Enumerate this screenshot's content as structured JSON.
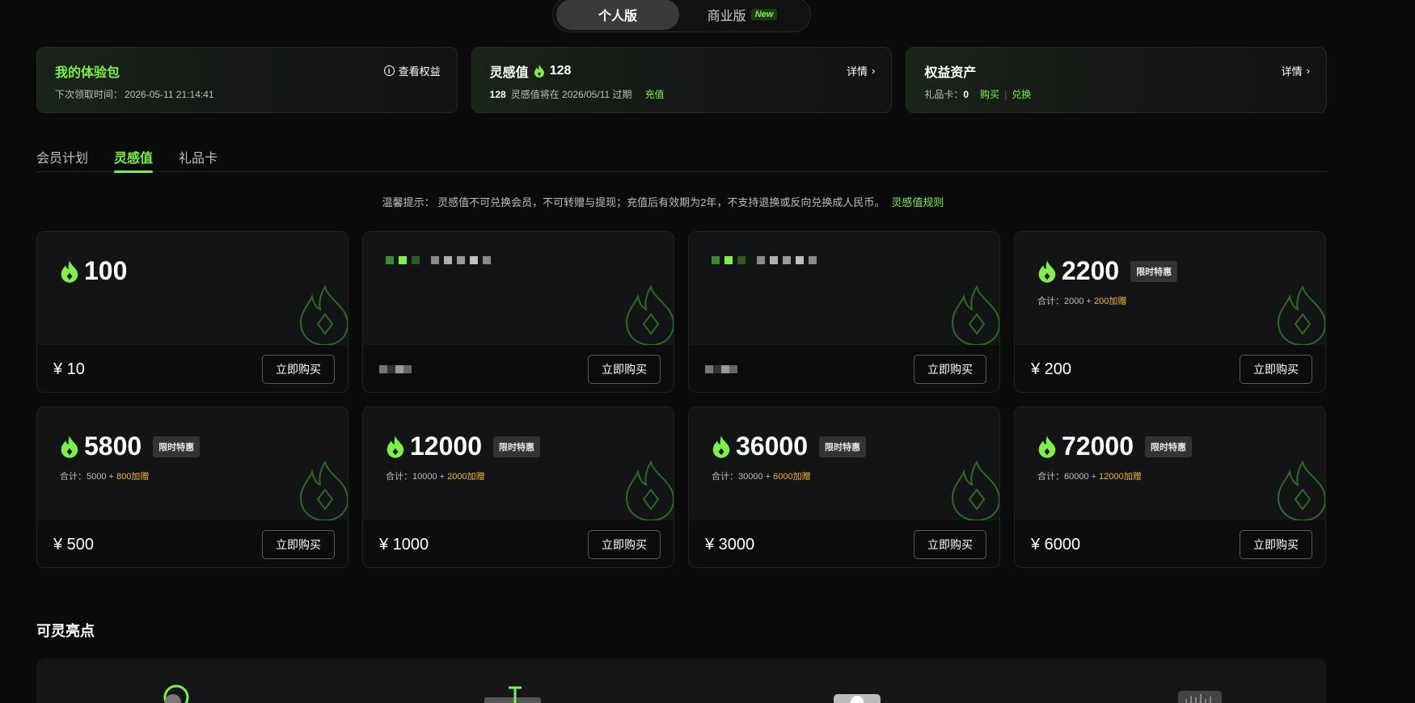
{
  "version_toggle": {
    "personal": "个人版",
    "business": "商业版",
    "new_badge": "New"
  },
  "info_cards": {
    "trial": {
      "title": "我的体验包",
      "next_label": "下次领取时间：",
      "next_time": "2026-05-11 21:14:41",
      "action": "查看权益"
    },
    "inspiration": {
      "title": "灵感值",
      "value": "128",
      "expire_amount": "128",
      "expire_text": "灵感值将在 2026/05/11 过期",
      "recharge": "充值",
      "action": "详情"
    },
    "assets": {
      "title": "权益资产",
      "gift_label": "礼品卡：",
      "gift_count": "0",
      "buy": "购买",
      "sep": "|",
      "redeem": "兑换",
      "action": "详情"
    }
  },
  "tabs": [
    "会员计划",
    "灵感值",
    "礼品卡"
  ],
  "active_tab": 1,
  "notice": {
    "text": "温馨提示： 灵感值不可兑换会员，不可转赠与提现；充值后有效期为2年，不支持退换或反向兑换成人民币。",
    "link": "灵感值规则"
  },
  "products": [
    {
      "amount": "100",
      "price": "¥ 10",
      "buy": "立即购买"
    },
    {
      "amount": "",
      "price": "",
      "buy": "立即购买",
      "redacted": true
    },
    {
      "amount": "",
      "price": "",
      "buy": "立即购买",
      "redacted": true
    },
    {
      "amount": "2200",
      "limited": "限时特惠",
      "total_label": "合计：2000 + ",
      "gift": "200加赠",
      "price": "¥ 200",
      "buy": "立即购买"
    },
    {
      "amount": "5800",
      "limited": "限时特惠",
      "total_label": "合计：5000 + ",
      "gift": "800加赠",
      "price": "¥ 500",
      "buy": "立即购买"
    },
    {
      "amount": "12000",
      "limited": "限时特惠",
      "total_label": "合计：10000 + ",
      "gift": "2000加赠",
      "price": "¥ 1000",
      "buy": "立即购买"
    },
    {
      "amount": "36000",
      "limited": "限时特惠",
      "total_label": "合计：30000 + ",
      "gift": "6000加赠",
      "price": "¥ 3000",
      "buy": "立即购买"
    },
    {
      "amount": "72000",
      "limited": "限时特惠",
      "total_label": "合计：60000 + ",
      "gift": "12000加赠",
      "price": "¥ 6000",
      "buy": "立即购买"
    }
  ],
  "section_title": "可灵亮点",
  "colors": {
    "accent": "#7ef04a",
    "gift": "#f2b63c",
    "background": "#0a0a0a"
  }
}
